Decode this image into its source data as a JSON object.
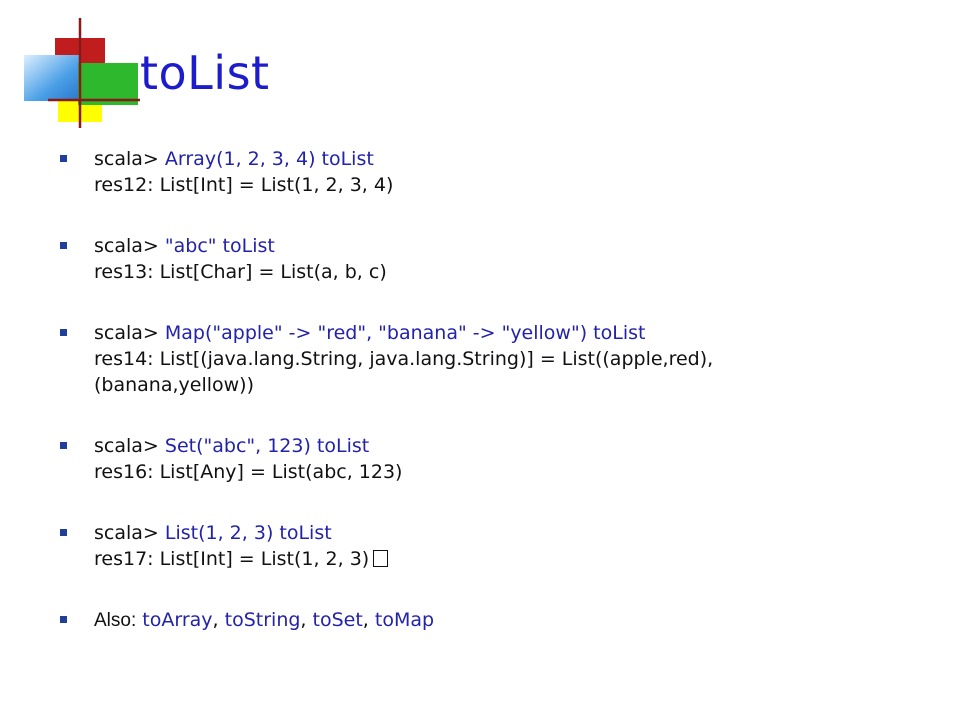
{
  "slide": {
    "title": "toList",
    "title_color": "#1c1ccc",
    "text_color": "#111111",
    "accent_blue": "#2222aa",
    "bullet_color": "#1f3f9a",
    "logo_colors": {
      "red": "#c01e1e",
      "yellow": "#ffff00",
      "green": "#2db82d",
      "blue": "#4a9fe6",
      "line": "#8a1a1a"
    }
  },
  "bullets": [
    {
      "prompt": "scala>",
      "command": "Array(1, 2, 3, 4) toList",
      "result": "res12: List[Int] = List(1, 2, 3, 4)"
    },
    {
      "prompt": "scala>",
      "command": "\"abc\" toList",
      "result": "res13: List[Char] = List(a, b, c)"
    },
    {
      "prompt": "scala>",
      "command": "Map(\"apple\" -> \"red\", \"banana\" -> \"yellow\") toList",
      "result": "res14: List[(java.lang.String, java.lang.String)] = List((apple,red),",
      "result_cont": "(banana,yellow))"
    },
    {
      "prompt": "scala>",
      "command": "Set(\"abc\", 123) toList",
      "result": "res16: List[Any] = List(abc, 123)"
    },
    {
      "prompt": "scala>",
      "command": "List(1, 2, 3) toList",
      "result": "res17: List[Int] = List(1, 2, 3)"
    }
  ],
  "also": {
    "label": "Also:",
    "items": [
      "toArray",
      "toString",
      "toSet",
      "toMap"
    ],
    "separator": ", "
  },
  "icons": {
    "bullet_marker": "square-bullet-icon",
    "logo": "colored-squares-logo-icon",
    "unknown_glyph": "box-glyph-icon"
  }
}
